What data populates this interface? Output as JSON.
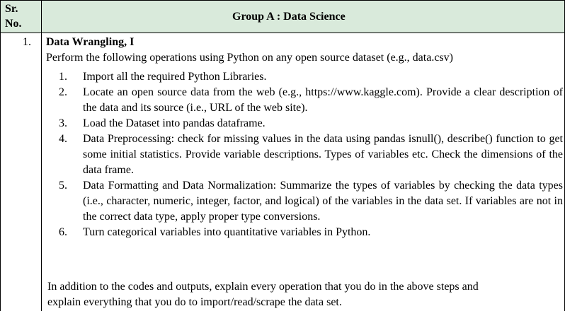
{
  "header": {
    "sr_line1": "Sr.",
    "sr_line2": "No.",
    "group_title": "Group A : Data Science"
  },
  "row": {
    "number": "1.",
    "title": "Data Wrangling, I",
    "intro": "Perform the following operations using Python on any open source dataset (e.g., data.csv)",
    "steps": [
      {
        "num": "1.",
        "text": "Import all the required Python Libraries."
      },
      {
        "num": "2.",
        "text": "Locate an open source data from the web (e.g., https://www.kaggle.com). Provide a clear description of the data and its source (i.e., URL of the web site)."
      },
      {
        "num": "3.",
        "text": "Load the Dataset into pandas dataframe."
      },
      {
        "num": "4.",
        "text": "Data Preprocessing: check for missing values in the data using pandas isnull(), describe() function to get some initial statistics. Provide variable descriptions. Types of variables etc. Check the dimensions of the data frame."
      },
      {
        "num": "5.",
        "text": "Data Formatting and Data Normalization: Summarize the types of variables by checking the data types (i.e., character, numeric, integer, factor, and logical) of the variables in the data set. If variables are not in the correct data type, apply proper type conversions."
      },
      {
        "num": "6.",
        "text": "Turn categorical variables into quantitative variables in Python."
      }
    ],
    "closing_line1": "In addition to the codes and outputs, explain every operation that you do in the above steps and",
    "closing_line2": "explain everything that you do to import/read/scrape the data set."
  },
  "colors": {
    "header_background": "#d9eadb",
    "border": "#000000",
    "text": "#000000"
  }
}
